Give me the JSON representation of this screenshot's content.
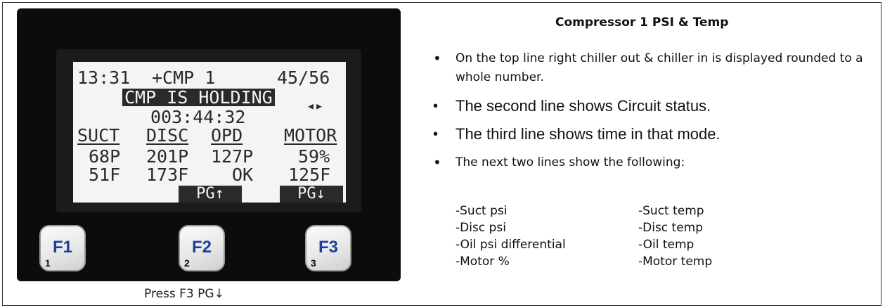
{
  "device": {
    "lcd": {
      "line1_time": "13:31",
      "line1_cmp": "+CMP 1",
      "line1_temps": "45/56",
      "line2_status": "CMP IS HOLDING",
      "line3_timer": "003:44:32",
      "arrows": "◂▸",
      "headers": [
        "SUCT",
        "DISC",
        "OPD",
        "MOTOR"
      ],
      "row1": [
        "68P",
        "201P",
        "127P",
        "59%"
      ],
      "row2": [
        "51F",
        "173F",
        "OK",
        "125F"
      ],
      "softkeys": [
        "PG↑",
        "PG↓"
      ]
    },
    "keys": [
      {
        "label": "F1",
        "num": "1"
      },
      {
        "label": "F2",
        "num": "2"
      },
      {
        "label": "F3",
        "num": "3"
      }
    ]
  },
  "caption": "Press F3 PG↓",
  "title": "Compressor 1 PSI & Temp",
  "bullets": [
    "On the top line right chiller out & chiller in is displayed rounded to a whole number.",
    "The second line shows Circuit status.",
    "The third line shows time in that mode.",
    "The next two lines show the following:"
  ],
  "list_left": [
    "-Suct psi",
    "-Disc psi",
    "-Oil psi differential",
    "-Motor %"
  ],
  "list_right": [
    "-Suct temp",
    "-Disc temp",
    "-Oil temp",
    "-Motor temp"
  ]
}
